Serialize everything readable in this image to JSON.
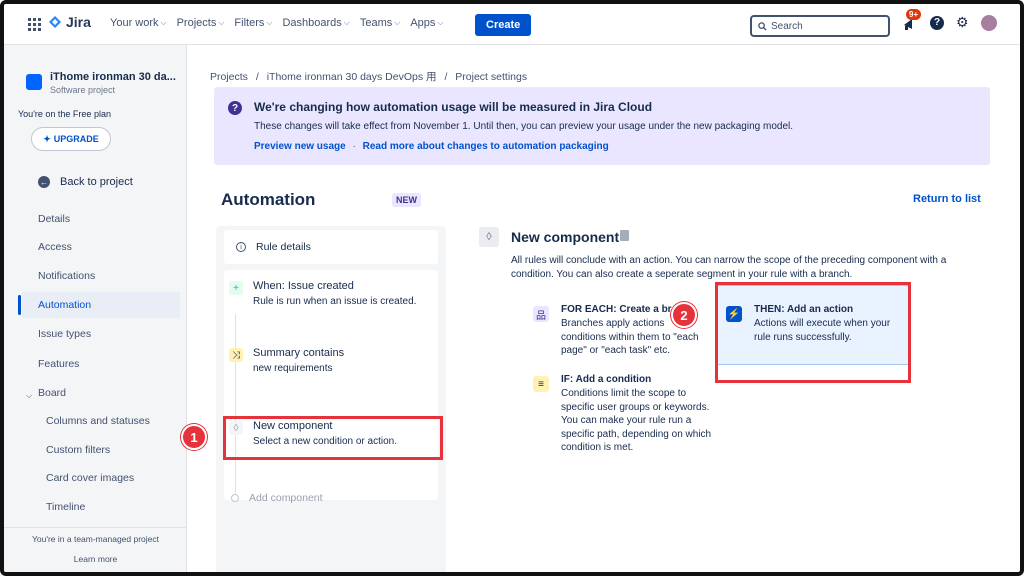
{
  "topbar": {
    "logo": "Jira",
    "nav": [
      {
        "label": "Your work"
      },
      {
        "label": "Projects"
      },
      {
        "label": "Filters"
      },
      {
        "label": "Dashboards"
      },
      {
        "label": "Teams"
      },
      {
        "label": "Apps"
      }
    ],
    "create_label": "Create",
    "search_placeholder": "Search",
    "notif_badge": "9+",
    "help_glyph": "?"
  },
  "sidebar": {
    "project_name": "iThome ironman 30 da...",
    "project_type": "Software project",
    "plan_text": "You're on the Free plan",
    "upgrade_label": "UPGRADE",
    "back_label": "Back to project",
    "items": [
      {
        "label": "Details"
      },
      {
        "label": "Access"
      },
      {
        "label": "Notifications"
      },
      {
        "label": "Automation"
      },
      {
        "label": "Issue types"
      },
      {
        "label": "Features"
      },
      {
        "label": "Board"
      },
      {
        "label": "Columns and statuses"
      },
      {
        "label": "Custom filters"
      },
      {
        "label": "Card cover images"
      },
      {
        "label": "Timeline"
      }
    ],
    "footer_text": "You're in a team-managed project",
    "learn_more": "Learn more"
  },
  "breadcrumb": {
    "projects": "Projects",
    "project": "iThome ironman 30 days DevOps 用",
    "settings": "Project settings",
    "sep": "/"
  },
  "banner": {
    "title": "We're changing how automation usage will be measured in Jira Cloud",
    "desc": "These changes will take effect from November 1. Until then, you can preview your usage under the new packaging model.",
    "link1": "Preview new usage",
    "dot": "·",
    "link2": "Read more about changes to automation packaging"
  },
  "page": {
    "title": "Automation",
    "badge": "NEW",
    "return_label": "Return to list"
  },
  "rule": {
    "details_label": "Rule details",
    "trigger_title": "When: Issue created",
    "trigger_desc": "Rule is run when an issue is created.",
    "cond_title": "Summary contains",
    "cond_desc": "new requirements",
    "new_title": "New component",
    "new_desc": "Select a new condition or action.",
    "add_label": "Add component"
  },
  "component": {
    "title": "New component",
    "desc": "All rules will conclude with an action. You can narrow the scope of the preceding component with a condition. You can also create a seperate segment in your rule with a branch.",
    "options": [
      {
        "title": "FOR EACH: Create a br",
        "desc": "Branches apply actions  conditions within them to \"each page\" or \"each task\" etc."
      },
      {
        "title": "IF: Add a condition",
        "desc": "Conditions limit the scope to specific user groups or keywords. You can make your rule run a specific path, depending on which condition is met."
      },
      {
        "title": "THEN: Add an action",
        "desc": "Actions will execute when your rule runs successfully."
      }
    ]
  },
  "callouts": [
    "1",
    "2"
  ],
  "colors": {
    "accent": "#0052cc",
    "highlight": "#e5323b",
    "banner": "#eae6ff"
  }
}
